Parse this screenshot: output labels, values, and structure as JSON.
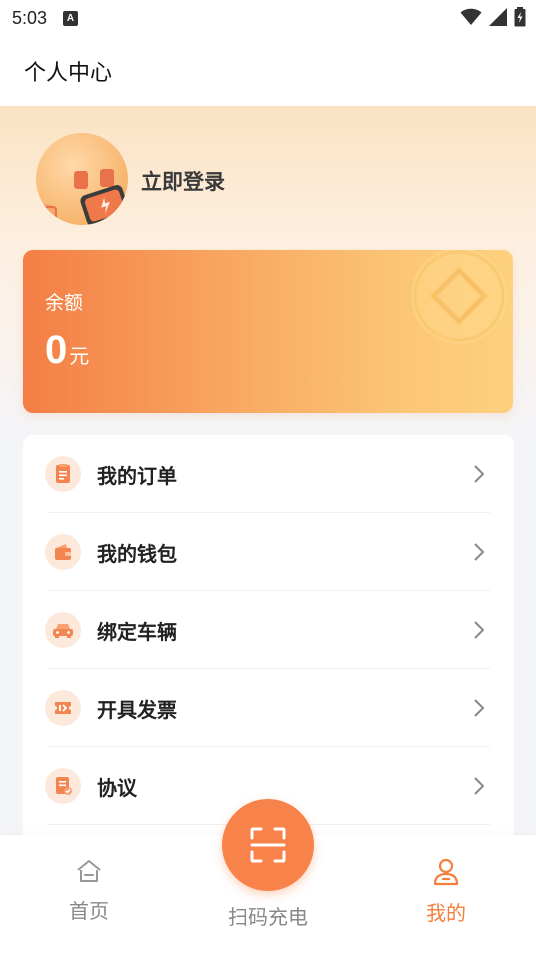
{
  "status_bar": {
    "time": "5:03",
    "notification_badge": "A"
  },
  "header": {
    "title": "个人中心"
  },
  "profile": {
    "login_label": "立即登录"
  },
  "balance": {
    "label": "余额",
    "value": "0",
    "unit": "元"
  },
  "menu": {
    "items": [
      {
        "label": "我的订单",
        "icon": "order-list-icon"
      },
      {
        "label": "我的钱包",
        "icon": "wallet-icon"
      },
      {
        "label": "绑定车辆",
        "icon": "car-icon"
      },
      {
        "label": "开具发票",
        "icon": "invoice-icon"
      },
      {
        "label": "协议",
        "icon": "agreement-icon"
      }
    ]
  },
  "bottom_nav": {
    "home_label": "首页",
    "scan_label": "扫码充电",
    "mine_label": "我的",
    "active_tab": "mine"
  },
  "colors": {
    "accent": "#f8834a",
    "active_tab": "#f47e3c",
    "card_gradient_start": "#f47e45",
    "card_gradient_end": "#fdd17f"
  }
}
